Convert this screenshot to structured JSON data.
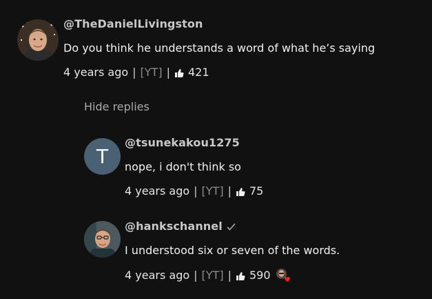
{
  "comments": [
    {
      "handle": "@TheDanielLivingston",
      "text": "Do you think he understands a word of what he’s saying",
      "time": "4 years ago",
      "source": "[YT]",
      "likes": "421"
    }
  ],
  "hide_replies_label": "Hide replies",
  "replies": [
    {
      "avatar_letter": "T",
      "handle": "@tsunekakou1275",
      "text": "nope, i don't think so",
      "time": "4 years ago",
      "source": "[YT]",
      "likes": "75"
    },
    {
      "handle": "@hankschannel",
      "verified": true,
      "text": "I understood six or seven of the words.",
      "time": "4 years ago",
      "source": "[YT]",
      "likes": "590",
      "creator_heart": true
    }
  ],
  "separator": "|",
  "colors": {
    "background": "#111111",
    "handle": "#c8c8c8",
    "source": "#8c8c8c",
    "avatar_t": "#4a6073",
    "heart": "#e8232a"
  },
  "icons": {
    "like": "thumbs-up-icon",
    "verified": "check-icon",
    "heart": "creator-heart-icon"
  }
}
